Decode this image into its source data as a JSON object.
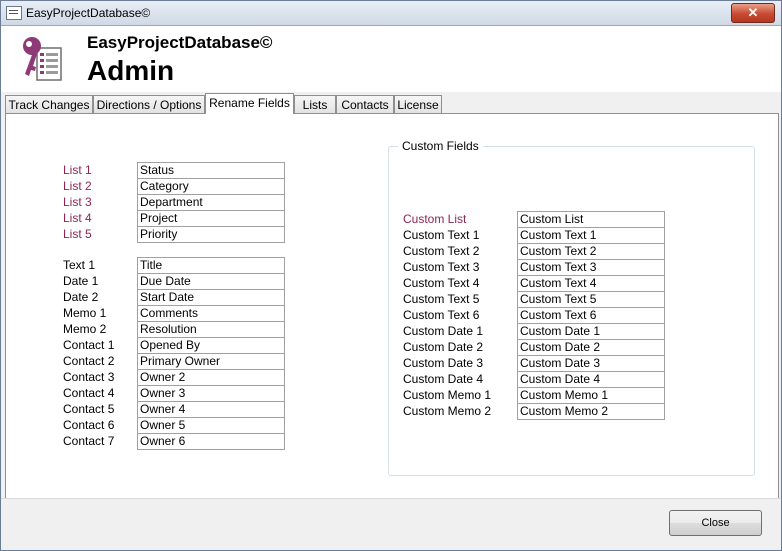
{
  "window": {
    "title": "EasyProjectDatabase©",
    "close_glyph": "✕"
  },
  "header": {
    "app_name": "EasyProjectDatabase©",
    "page_title": "Admin"
  },
  "tabs": [
    "Track Changes",
    "Directions / Options",
    "Rename Fields",
    "Lists",
    "Contacts",
    "License"
  ],
  "active_tab": "Rename Fields",
  "lists": [
    {
      "label": "List 1",
      "value": "Status"
    },
    {
      "label": "List 2",
      "value": "Category"
    },
    {
      "label": "List 3",
      "value": "Department"
    },
    {
      "label": "List 4",
      "value": "Project"
    },
    {
      "label": "List 5",
      "value": "Priority"
    }
  ],
  "fields": [
    {
      "label": "Text 1",
      "value": "Title"
    },
    {
      "label": "Date 1",
      "value": "Due Date"
    },
    {
      "label": "Date 2",
      "value": "Start Date"
    },
    {
      "label": "Memo 1",
      "value": "Comments"
    },
    {
      "label": "Memo 2",
      "value": "Resolution"
    },
    {
      "label": "Contact 1",
      "value": "Opened By"
    },
    {
      "label": "Contact 2",
      "value": "Primary Owner"
    },
    {
      "label": "Contact 3",
      "value": "Owner 2"
    },
    {
      "label": "Contact 4",
      "value": "Owner 3"
    },
    {
      "label": "Contact 5",
      "value": "Owner 4"
    },
    {
      "label": "Contact 6",
      "value": "Owner 5"
    },
    {
      "label": "Contact 7",
      "value": "Owner 6"
    }
  ],
  "custom": {
    "title": "Custom Fields",
    "rows": [
      {
        "label": "Custom List",
        "value": "Custom List"
      },
      {
        "label": "Custom Text 1",
        "value": "Custom Text 1"
      },
      {
        "label": "Custom Text 2",
        "value": "Custom Text 2"
      },
      {
        "label": "Custom Text 3",
        "value": "Custom Text 3"
      },
      {
        "label": "Custom Text 4",
        "value": "Custom Text 4"
      },
      {
        "label": "Custom Text 5",
        "value": "Custom Text 5"
      },
      {
        "label": "Custom Text 6",
        "value": "Custom Text 6"
      },
      {
        "label": "Custom Date 1",
        "value": "Custom Date 1"
      },
      {
        "label": "Custom Date 2",
        "value": "Custom Date 2"
      },
      {
        "label": "Custom Date 3",
        "value": "Custom Date 3"
      },
      {
        "label": "Custom Date 4",
        "value": "Custom Date 4"
      },
      {
        "label": "Custom Memo 1",
        "value": "Custom Memo 1"
      },
      {
        "label": "Custom Memo 2",
        "value": "Custom Memo 2"
      }
    ]
  },
  "footer": {
    "close_label": "Close"
  },
  "colors": {
    "list_label": "#8b2655",
    "logo": "#8e3a78"
  },
  "icons": {
    "app": "app-window-icon",
    "logo": "key-form-icon"
  }
}
